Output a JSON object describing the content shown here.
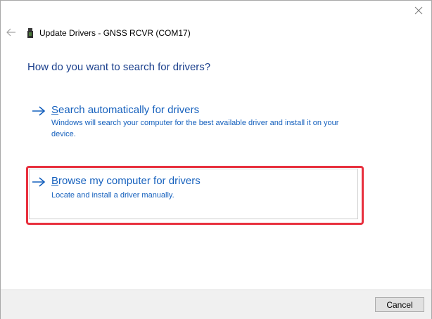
{
  "window": {
    "title": "Update Drivers - GNSS RCVR (COM17)",
    "close_icon": "close-icon",
    "back_icon": "back-arrow-icon",
    "device_icon": "usb-device-icon"
  },
  "main": {
    "heading": "How do you want to search for drivers?",
    "options": [
      {
        "accel": "S",
        "title_rest": "earch automatically for drivers",
        "description": "Windows will search your computer for the best available driver and install it on your device.",
        "icon": "arrow-right-icon"
      },
      {
        "accel": "B",
        "title_rest": "rowse my computer for drivers",
        "description": "Locate and install a driver manually.",
        "icon": "arrow-right-icon",
        "highlighted": true
      }
    ]
  },
  "footer": {
    "cancel_label": "Cancel"
  },
  "colors": {
    "heading": "#1a3f8c",
    "link": "#1560bd",
    "highlight": "#e8303e",
    "footer_bg": "#f0f0f0"
  }
}
